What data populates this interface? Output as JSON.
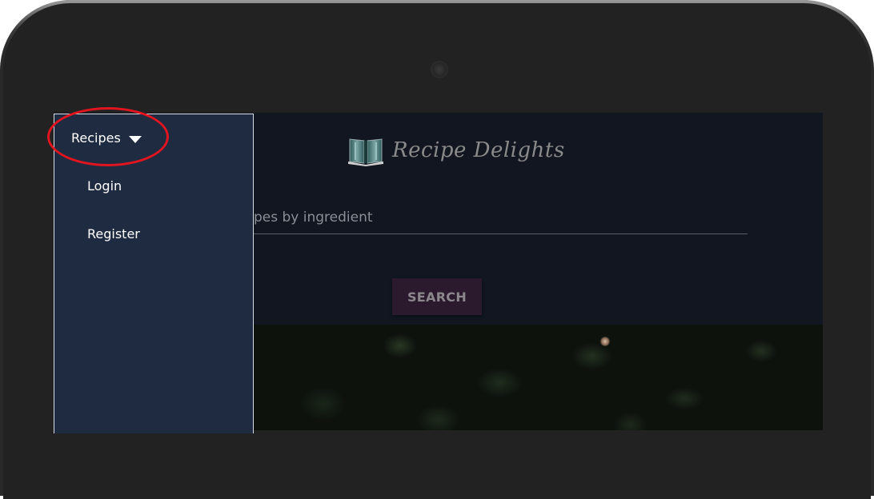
{
  "app": {
    "title": "Recipe Delights"
  },
  "sidebar": {
    "items": [
      {
        "label": "Recipes",
        "has_dropdown": true,
        "icon": "caret-down-icon"
      },
      {
        "label": "Login"
      },
      {
        "label": "Register"
      }
    ]
  },
  "search": {
    "value": "",
    "placeholder": "pes by ingredient",
    "button_label": "SEARCH"
  },
  "colors": {
    "sidebar_bg": "#1f2b41",
    "header_bg": "#111621",
    "search_button_bg": "#2b1a2e",
    "highlight_ring": "#e0151f",
    "logo_icon": "#3f6b6b"
  },
  "icons": {
    "logo": "open-book-icon",
    "camera": "camera-icon"
  }
}
